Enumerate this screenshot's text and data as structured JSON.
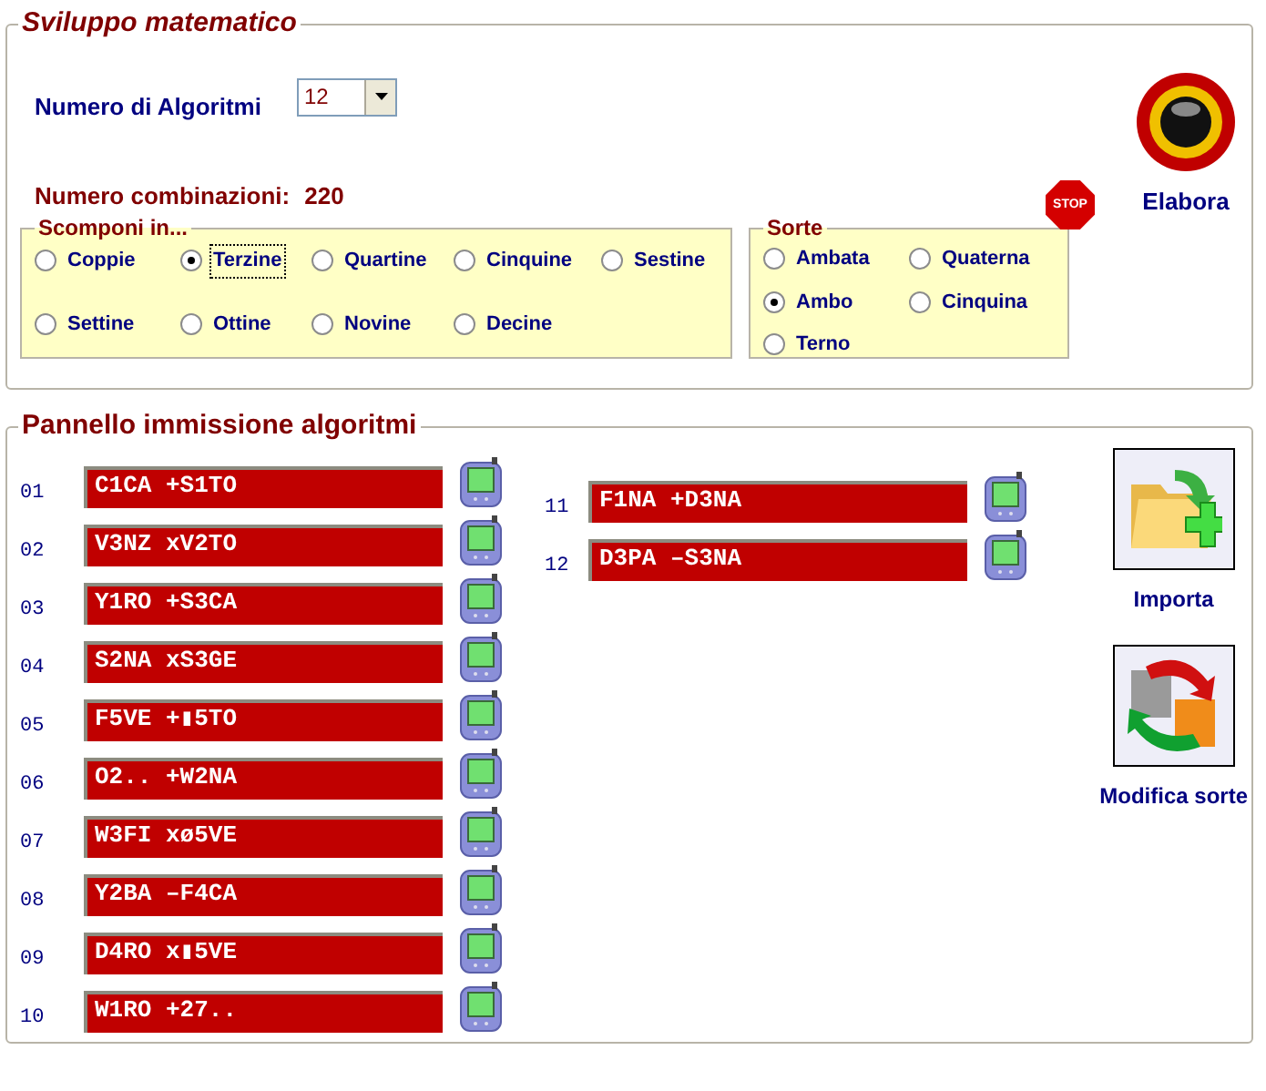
{
  "sviluppo": {
    "title": "Sviluppo matematico",
    "algorithm_count": {
      "label": "Numero di Algoritmi",
      "value": "12"
    },
    "combinations": {
      "label": "Numero combinazioni:",
      "value": "220"
    },
    "stop_button": {
      "label": "STOP"
    },
    "run_button": {
      "label": "Elabora"
    },
    "scomponi": {
      "title": "Scomponi in...",
      "options": [
        {
          "label": "Coppie",
          "selected": false
        },
        {
          "label": "Terzine",
          "selected": true
        },
        {
          "label": "Quartine",
          "selected": false
        },
        {
          "label": "Cinquine",
          "selected": false
        },
        {
          "label": "Sestine",
          "selected": false
        },
        {
          "label": "Settine",
          "selected": false
        },
        {
          "label": "Ottine",
          "selected": false
        },
        {
          "label": "Novine",
          "selected": false
        },
        {
          "label": "Decine",
          "selected": false
        }
      ]
    },
    "sorte": {
      "title": "Sorte",
      "options": [
        {
          "label": "Ambata",
          "selected": false
        },
        {
          "label": "Quaterna",
          "selected": false
        },
        {
          "label": "Ambo",
          "selected": true
        },
        {
          "label": "Cinquina",
          "selected": false
        },
        {
          "label": "Terno",
          "selected": false
        }
      ]
    }
  },
  "pannello": {
    "title": "Pannello immissione algoritmi",
    "algorithms": [
      {
        "number": "01",
        "value": "C1CA +S1TO"
      },
      {
        "number": "02",
        "value": "V3NZ xV2TO"
      },
      {
        "number": "03",
        "value": "Y1RO +S3CA"
      },
      {
        "number": "04",
        "value": "S2NA xS3GE"
      },
      {
        "number": "05",
        "value": "F5VE +▮5TO"
      },
      {
        "number": "06",
        "value": "O2.. +W2NA"
      },
      {
        "number": "07",
        "value": "W3FI xø5VE"
      },
      {
        "number": "08",
        "value": "Y2BA –F4CA"
      },
      {
        "number": "09",
        "value": "D4RO x▮5VE"
      },
      {
        "number": "10",
        "value": "W1RO +27.."
      },
      {
        "number": "11",
        "value": "F1NA +D3NA"
      },
      {
        "number": "12",
        "value": "D3PA –S3NA"
      }
    ],
    "buttons": [
      {
        "kind": "import",
        "label": "Importa"
      },
      {
        "kind": "modify",
        "label": "Modifica sorte"
      }
    ]
  }
}
